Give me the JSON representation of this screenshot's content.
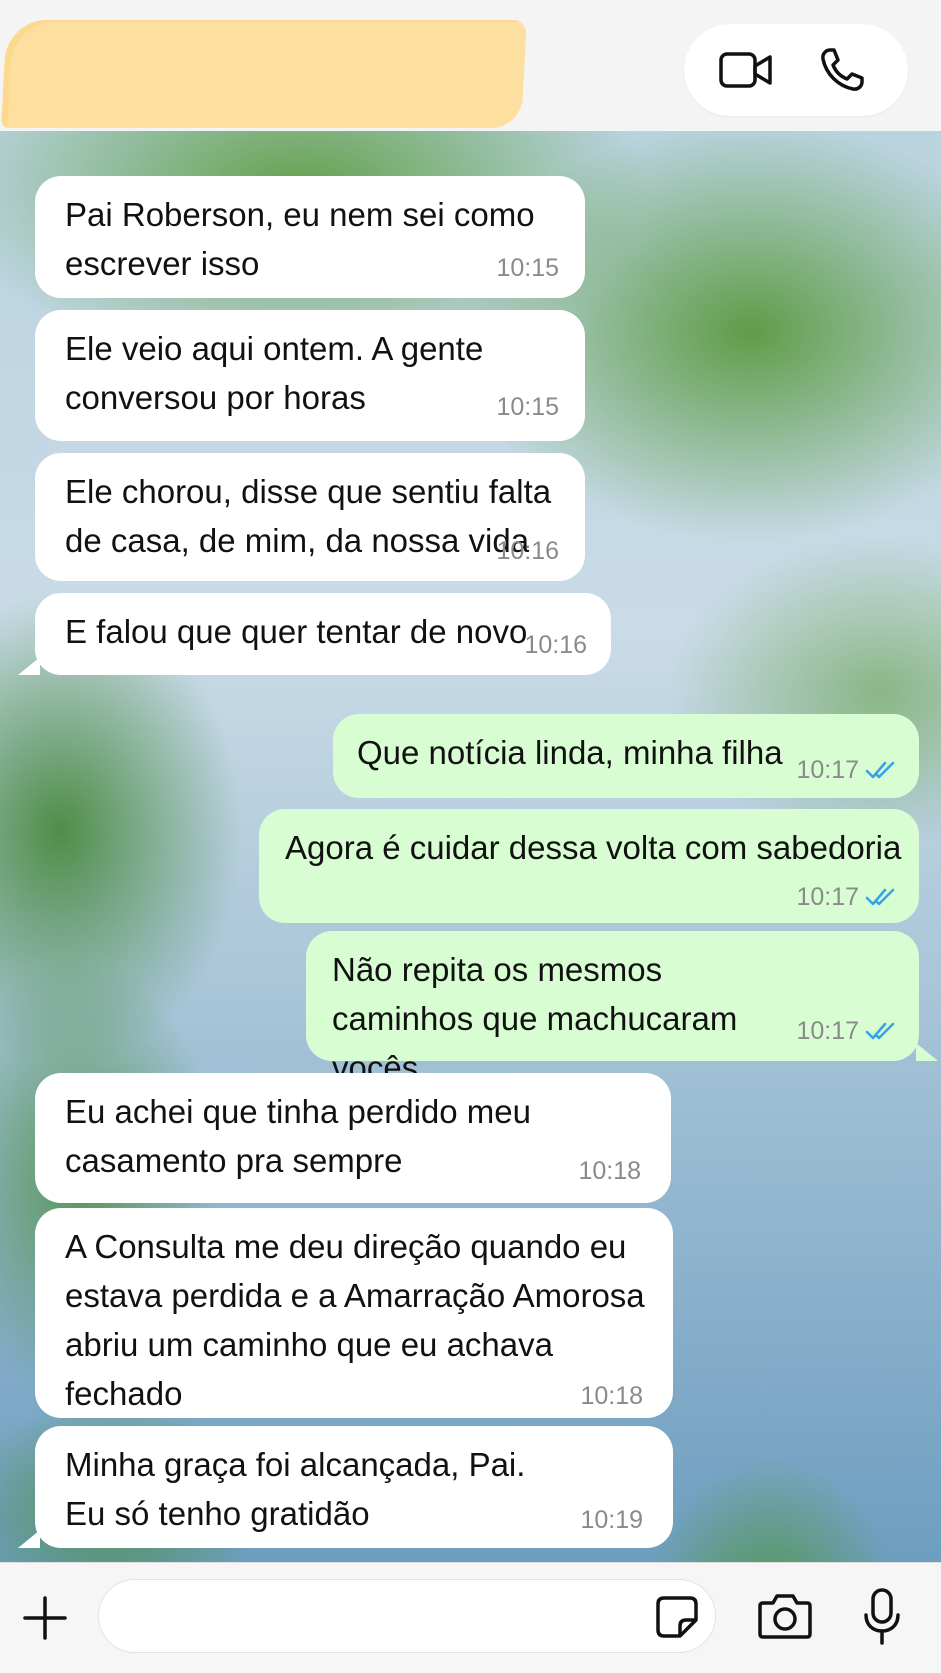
{
  "header": {
    "video_call_label": "video-call",
    "voice_call_label": "voice-call"
  },
  "messages": [
    {
      "dir": "in",
      "text": "Pai Roberson, eu nem sei como escrever isso",
      "time": "10:15"
    },
    {
      "dir": "in",
      "text": "Ele veio aqui ontem. A gente conversou por horas",
      "time": "10:15"
    },
    {
      "dir": "in",
      "text": "Ele chorou, disse que sentiu falta de casa, de mim, da nossa vida",
      "time": "10:16"
    },
    {
      "dir": "in",
      "text": "E falou que quer tentar de novo",
      "time": "10:16"
    },
    {
      "dir": "out",
      "text": "Que notícia linda, minha filha",
      "time": "10:17",
      "status": "read"
    },
    {
      "dir": "out",
      "text": "Agora é cuidar dessa volta com sabedoria",
      "time": "10:17",
      "status": "read"
    },
    {
      "dir": "out",
      "text": "Não repita os mesmos caminhos que machucaram vocês",
      "time": "10:17",
      "status": "read"
    },
    {
      "dir": "in",
      "text": "Eu achei que tinha perdido meu casamento pra sempre",
      "time": "10:18"
    },
    {
      "dir": "in",
      "text": "A Consulta me deu direção quando eu estava perdida e a Amarração Amorosa abriu um caminho que eu achava fechado",
      "time": "10:18"
    },
    {
      "dir": "in",
      "text": "Minha graça foi alcançada, Pai. Eu só tenho gratidão",
      "time": "10:19"
    }
  ],
  "footer": {
    "input_value": "",
    "input_placeholder": ""
  },
  "colors": {
    "incoming_bubble": "#ffffff",
    "outgoing_bubble": "#d9fdd3",
    "read_ticks": "#34a3e6",
    "timestamp": "#8a8a8a"
  }
}
